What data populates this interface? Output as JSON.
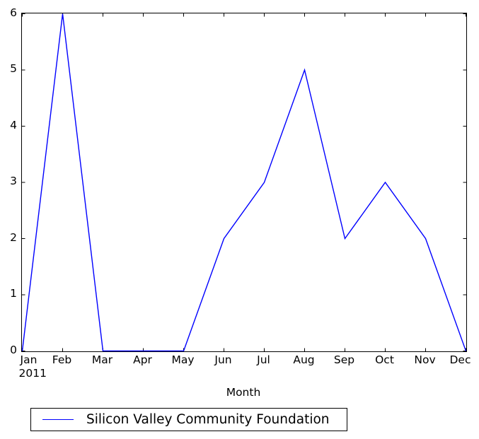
{
  "chart_data": {
    "type": "line",
    "title": "",
    "xlabel": "Month",
    "ylabel": "",
    "categories": [
      "Jan",
      "Feb",
      "Mar",
      "Apr",
      "May",
      "Jun",
      "Jul",
      "Aug",
      "Sep",
      "Oct",
      "Nov",
      "Dec"
    ],
    "x_sublabels": [
      "2011",
      "",
      "",
      "",
      "",
      "",
      "",
      "",
      "",
      "",
      "",
      ""
    ],
    "series": [
      {
        "name": "Silicon Valley Community Foundation",
        "color": "#0000ff",
        "values": [
          0,
          6,
          0,
          0,
          0,
          2,
          3,
          5,
          2,
          3,
          2,
          0
        ]
      }
    ],
    "xlim": [
      "Jan",
      "Dec"
    ],
    "ylim": [
      0,
      6
    ],
    "yticks": [
      0,
      1,
      2,
      3,
      4,
      5,
      6
    ],
    "ytick_labels": [
      "0",
      "1",
      "2",
      "3",
      "4",
      "5",
      "6"
    ],
    "grid": false,
    "legend_position": "below-axes",
    "frame": true,
    "tick_direction": "in"
  },
  "axes": {
    "xlabel": "Month",
    "year_label": "2011"
  },
  "legend": {
    "entries": [
      {
        "label": "Silicon Valley Community Foundation",
        "color": "#0000ff"
      }
    ]
  },
  "colors": {
    "line": "#0000ff",
    "axis": "#000000",
    "background": "#ffffff",
    "text": "#000000"
  }
}
